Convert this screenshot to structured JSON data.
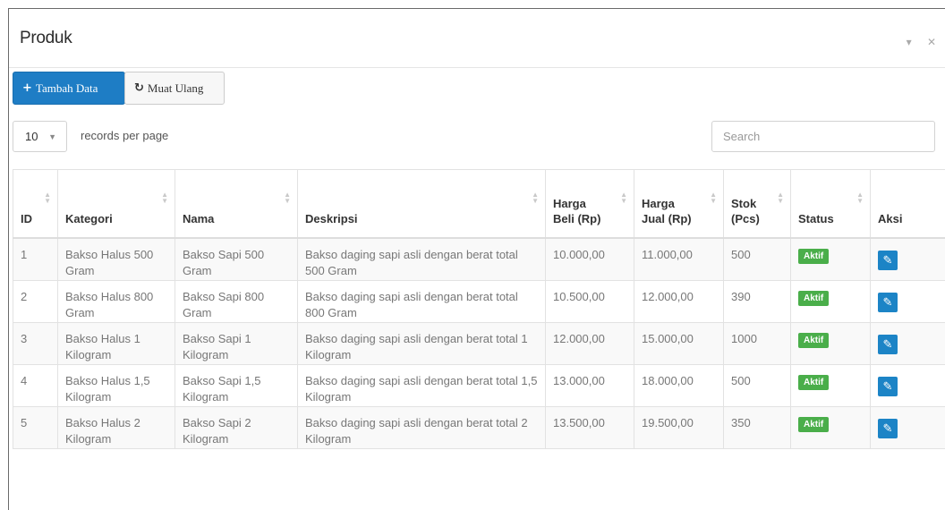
{
  "panel": {
    "title": "Produk",
    "collapse_glyph": "▾",
    "close_glyph": "✕"
  },
  "toolbar": {
    "add_label": "Tambah Data",
    "add_icon": "plus-icon",
    "reload_label": "Muat Ulang",
    "reload_icon": "refresh-icon"
  },
  "length": {
    "value": "10",
    "label": "records per page"
  },
  "search": {
    "placeholder": "Search"
  },
  "columns": [
    {
      "l1": "",
      "l2": "ID"
    },
    {
      "l1": "",
      "l2": "Kategori"
    },
    {
      "l1": "",
      "l2": "Nama"
    },
    {
      "l1": "",
      "l2": "Deskripsi"
    },
    {
      "l1": "Harga",
      "l2": "Beli (Rp)"
    },
    {
      "l1": "Harga",
      "l2": "Jual (Rp)"
    },
    {
      "l1": "Stok",
      "l2": "(Pcs)"
    },
    {
      "l1": "",
      "l2": "Status"
    },
    {
      "l1": "",
      "l2": "Aksi"
    }
  ],
  "rows": [
    {
      "id": "1",
      "kategori": "Bakso Halus 500 Gram",
      "nama": "Bakso Sapi 500 Gram",
      "deskripsi": "Bakso daging sapi asli dengan berat total 500 Gram",
      "beli": "10.000,00",
      "jual": "11.000,00",
      "stok": "500",
      "status": "Aktif"
    },
    {
      "id": "2",
      "kategori": "Bakso Halus 800 Gram",
      "nama": "Bakso Sapi 800 Gram",
      "deskripsi": "Bakso daging sapi asli dengan berat total 800 Gram",
      "beli": "10.500,00",
      "jual": "12.000,00",
      "stok": "390",
      "status": "Aktif"
    },
    {
      "id": "3",
      "kategori": "Bakso Halus 1 Kilogram",
      "nama": "Bakso Sapi 1 Kilogram",
      "deskripsi": "Bakso daging sapi asli dengan berat total 1 Kilogram",
      "beli": "12.000,00",
      "jual": "15.000,00",
      "stok": "1000",
      "status": "Aktif"
    },
    {
      "id": "4",
      "kategori": "Bakso Halus 1,5 Kilogram",
      "nama": "Bakso Sapi 1,5 Kilogram",
      "deskripsi": "Bakso daging sapi asli dengan berat total 1,5 Kilogram",
      "beli": "13.000,00",
      "jual": "18.000,00",
      "stok": "500",
      "status": "Aktif"
    },
    {
      "id": "5",
      "kategori": "Bakso Halus 2 Kilogram",
      "nama": "Bakso Sapi 2 Kilogram",
      "deskripsi": "Bakso daging sapi asli dengan berat total 2 Kilogram",
      "beli": "13.500,00",
      "jual": "19.500,00",
      "stok": "350",
      "status": "Aktif"
    }
  ],
  "colors": {
    "primary": "#1e7dc5",
    "success": "#4aae4a",
    "edit": "#1c84c6"
  }
}
